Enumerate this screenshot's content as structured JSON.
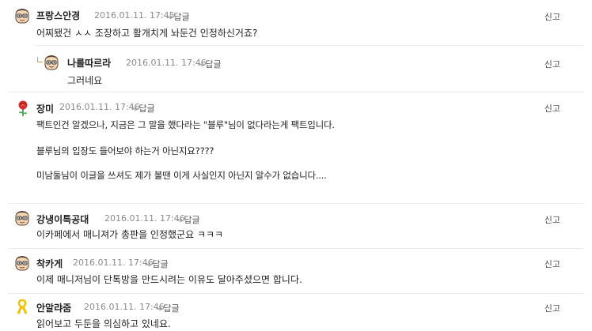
{
  "comments": [
    {
      "nick": "프랑스안경",
      "date": "2016.01.11. 17:45",
      "reply_label": "답글",
      "report_label": "신고",
      "lines": [
        "어찌됐건 ㅅㅅ 조장하고 활개치게 놔둔건 인정하신거죠?"
      ],
      "avatar_icon": "face-glasses-icon"
    },
    {
      "nick": "나를따르라",
      "date": "2016.01.11. 17:46",
      "reply_label": "답글",
      "report_label": "신고",
      "lines": [
        "그러네요"
      ],
      "avatar_icon": "face-glasses-icon"
    },
    {
      "nick": "장미",
      "date": "2016.01.11. 17:46",
      "reply_label": "답글",
      "report_label": "신고",
      "lines": [
        "팩트인건 알겠으나, 지금은 그 말을 했다라는 \"블루\"님이 없다라는게 팩트입니다.",
        "블루님의 입장도 들어보야 하는거 아닌지요????",
        "미남둘님이 이글을 쓰셔도 제가 볼땐 이게 사실인지 아닌지 알수가 없습니다...."
      ],
      "avatar_icon": "rose-icon"
    },
    {
      "nick": "강냉이특공대",
      "date": "2016.01.11. 17:46",
      "reply_label": "답글",
      "report_label": "신고",
      "lines": [
        "이카페에서 매니져가 총판을 인정했군요 ㅋㅋㅋ"
      ],
      "avatar_icon": "face-glasses-icon"
    },
    {
      "nick": "착카게",
      "date": "2016.01.11. 17:46",
      "reply_label": "답글",
      "report_label": "신고",
      "lines": [
        "이제 매니저님이 단톡방을 만드시려는 이유도 달아주셨으면 합니다."
      ],
      "avatar_icon": "face-glasses-icon"
    },
    {
      "nick": "안알랴줌",
      "date": "2016.01.11. 17:46",
      "reply_label": "답글",
      "report_label": "신고",
      "lines": [
        "읽어보고 두둔을 의심하고 있네요."
      ],
      "avatar_icon": "yellow-ribbon-icon"
    }
  ],
  "colors": {
    "text": "#222222",
    "date": "#8a8a8a",
    "divider": "#ececec",
    "reply_indent": "#e0a030"
  }
}
